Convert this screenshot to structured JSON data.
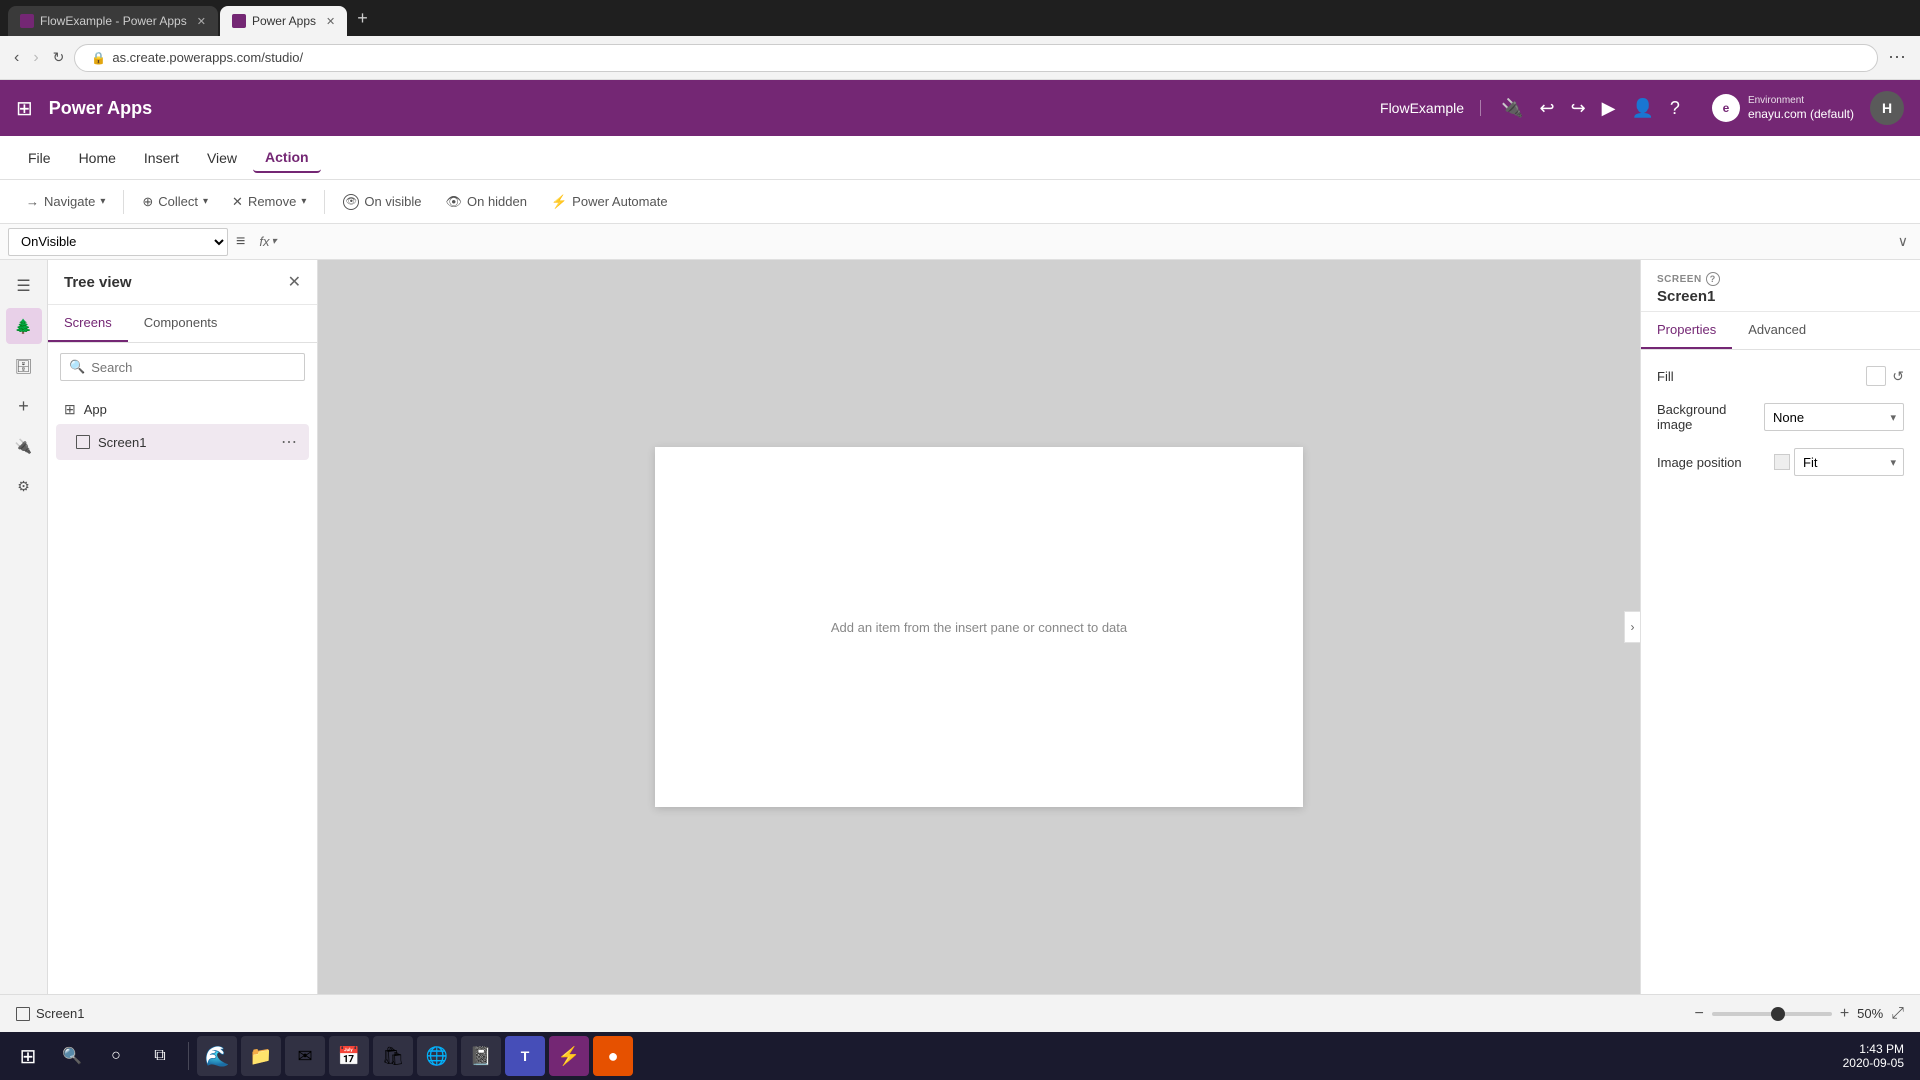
{
  "browser": {
    "tabs": [
      {
        "id": "tab1",
        "favicon": "powerapps",
        "label": "FlowExample - Power Apps",
        "active": false
      },
      {
        "id": "tab2",
        "favicon": "pa2",
        "label": "Power Apps",
        "active": true
      }
    ],
    "address": "as.create.powerapps.com/studio/",
    "add_tab_label": "+"
  },
  "header": {
    "app_icon": "⊞",
    "title": "Power Apps",
    "environment_label": "Environment",
    "environment_name": "enayu.com (default)",
    "env_icon_text": "e",
    "app_name": "FlowExample",
    "icons": [
      "🔌",
      "↩",
      "↪",
      "▶",
      "👤",
      "?"
    ],
    "avatar_text": "H"
  },
  "menu": {
    "items": [
      {
        "id": "file",
        "label": "File",
        "active": false
      },
      {
        "id": "home",
        "label": "Home",
        "active": false
      },
      {
        "id": "insert",
        "label": "Insert",
        "active": false
      },
      {
        "id": "view",
        "label": "View",
        "active": false
      },
      {
        "id": "action",
        "label": "Action",
        "active": true
      }
    ]
  },
  "toolbar": {
    "navigate": {
      "label": "Navigate",
      "icon": "→"
    },
    "collect": {
      "label": "Collect",
      "icon": "⊕"
    },
    "remove": {
      "label": "Remove",
      "icon": "✕"
    },
    "on_visible": {
      "label": "On visible",
      "icon": "👁"
    },
    "on_hidden": {
      "label": "On hidden",
      "icon": "👁"
    },
    "power_automate": {
      "label": "Power Automate",
      "icon": "⚡"
    }
  },
  "formula_bar": {
    "select_value": "OnVisible",
    "fx_label": "fx",
    "chevron": "∨"
  },
  "tree_view": {
    "title": "Tree view",
    "tabs": [
      "Screens",
      "Components"
    ],
    "active_tab": "Screens",
    "search_placeholder": "Search",
    "app_item": {
      "label": "App",
      "icon": "⊞"
    },
    "screens": [
      {
        "label": "Screen1",
        "id": "screen1"
      }
    ]
  },
  "canvas": {
    "hint_text": "Add an item from the insert pane or connect to data",
    "hint_link": "connect to data"
  },
  "properties": {
    "screen_label": "SCREEN",
    "screen_name": "Screen1",
    "tabs": [
      "Properties",
      "Advanced"
    ],
    "active_tab": "Properties",
    "fill_label": "Fill",
    "background_image_label": "Background image",
    "background_image_value": "None",
    "image_position_label": "Image position",
    "image_position_value": "Fit"
  },
  "status_bar": {
    "screen_label": "Screen1",
    "zoom_minus": "−",
    "zoom_plus": "+",
    "zoom_value": "50",
    "zoom_unit": "%"
  },
  "sidebar_icons": [
    {
      "id": "menu",
      "icon": "☰",
      "active": false
    },
    {
      "id": "tree",
      "icon": "🌳",
      "active": true
    },
    {
      "id": "data",
      "icon": "🗄",
      "active": false
    },
    {
      "id": "plus",
      "icon": "+",
      "active": false
    },
    {
      "id": "connector",
      "icon": "🔌",
      "active": false
    },
    {
      "id": "vars",
      "icon": "⚙",
      "active": false
    }
  ],
  "taskbar": {
    "start_icon": "⊞",
    "time": "1:43 PM",
    "date": "2020-09-05",
    "apps": [
      {
        "id": "search",
        "icon": "🔍",
        "bg": "#333"
      },
      {
        "id": "cortana",
        "icon": "○",
        "bg": "#333"
      },
      {
        "id": "taskview",
        "icon": "⧉",
        "bg": "#333"
      },
      {
        "id": "edge",
        "icon": "🌊",
        "bg": "#0078d4"
      },
      {
        "id": "explorer",
        "icon": "📁",
        "bg": "#f9a825"
      },
      {
        "id": "mail",
        "icon": "✉",
        "bg": "#0078d4"
      },
      {
        "id": "calendar",
        "icon": "📅",
        "bg": "#f3f3f3"
      },
      {
        "id": "store",
        "icon": "🛍",
        "bg": "#742774"
      },
      {
        "id": "chrome",
        "icon": "●",
        "bg": "#fff"
      },
      {
        "id": "onenote",
        "icon": "📓",
        "bg": "#7719aa"
      },
      {
        "id": "teams",
        "icon": "T",
        "bg": "#464eb8"
      },
      {
        "id": "pa3",
        "icon": "⚡",
        "bg": "#742774"
      },
      {
        "id": "orange",
        "icon": "●",
        "bg": "#e65100"
      }
    ]
  }
}
